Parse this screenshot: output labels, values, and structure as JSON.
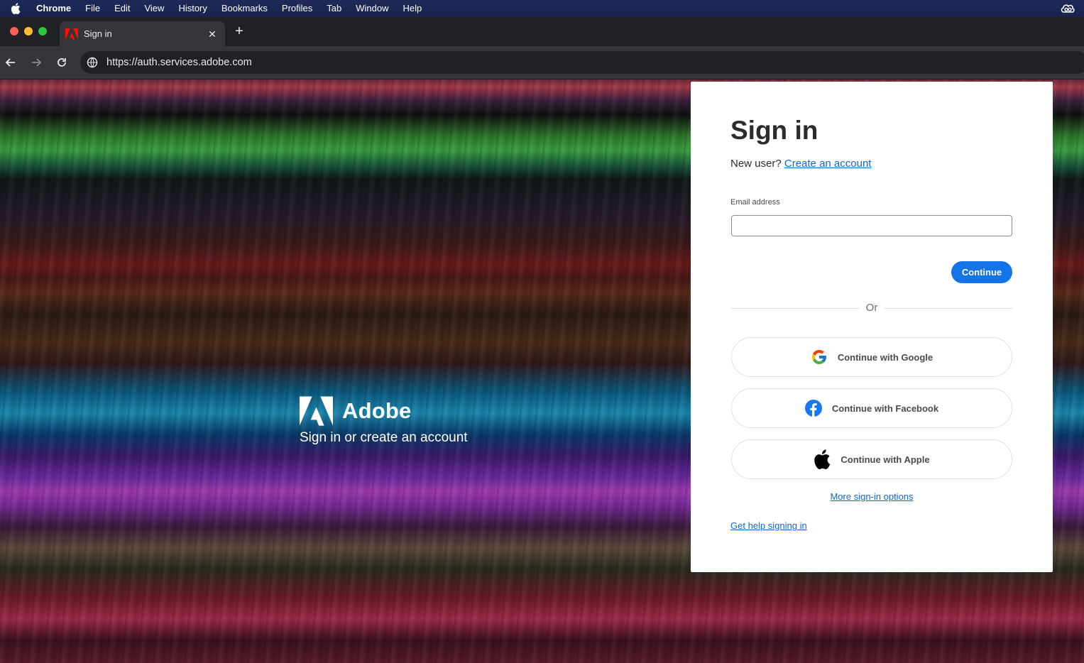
{
  "menubar": {
    "apple_icon": "apple-icon",
    "app_name": "Chrome",
    "items": [
      "File",
      "Edit",
      "View",
      "History",
      "Bookmarks",
      "Profiles",
      "Tab",
      "Window",
      "Help"
    ],
    "status_icon": "creative-cloud-icon"
  },
  "browser": {
    "tab": {
      "title": "Sign in",
      "favicon": "adobe-icon",
      "close": "✕"
    },
    "new_tab": "+",
    "url": "https://auth.services.adobe.com"
  },
  "brand": {
    "name": "Adobe",
    "tagline": "Sign in or create an account"
  },
  "signin": {
    "title": "Sign in",
    "new_user_text": "New user?",
    "create_account_link": "Create an account",
    "email_label": "Email address",
    "email_value": "",
    "continue_label": "Continue",
    "or_text": "Or",
    "google_label": "Continue with Google",
    "facebook_label": "Continue with Facebook",
    "apple_label": "Continue with Apple",
    "more_options_link": "More sign-in options",
    "help_link": "Get help signing in"
  },
  "colors": {
    "accent": "#1473e6",
    "link": "#0d66d0",
    "facebook": "#1877f2",
    "adobe_red": "#fa0f00"
  }
}
